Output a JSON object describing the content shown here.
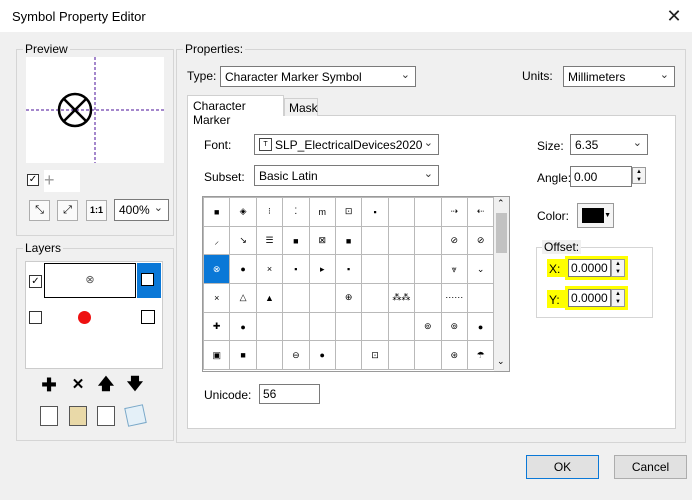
{
  "window": {
    "title": "Symbol Property Editor",
    "close_glyph": "✕"
  },
  "preview": {
    "label": "Preview",
    "zoom": "400%"
  },
  "layers": {
    "label": "Layers",
    "items": [
      {
        "checked": true,
        "symbol": "⊗",
        "lock": "⊡"
      },
      {
        "checked": false,
        "symbol": "●",
        "lock": "⧉"
      }
    ]
  },
  "properties": {
    "label": "Properties:",
    "type_label": "Type:",
    "type_value": "Character Marker Symbol",
    "units_label": "Units:",
    "units_value": "Millimeters",
    "tabs": [
      "Character Marker",
      "Mask"
    ],
    "font_label": "Font:",
    "font_value": "SLP_ElectricalDevices2020",
    "subset_label": "Subset:",
    "subset_value": "Basic Latin",
    "unicode_label": "Unicode:",
    "unicode_value": "56",
    "size_label": "Size:",
    "size_value": "6.35",
    "angle_label": "Angle:",
    "angle_value": "0.00",
    "color_label": "Color:",
    "color_value": "#000000",
    "offset_label": "Offset:",
    "x_label": "X:",
    "x_value": "0.0000",
    "y_label": "Y:",
    "y_value": "0.0000"
  },
  "glyphs": [
    [
      "■",
      "◈",
      "⁝",
      "⁚",
      "m",
      "⊡",
      "▪",
      "",
      "",
      "⇢",
      "⇠"
    ],
    [
      "⸝",
      "↘",
      "☰",
      "■",
      "⊠",
      "■",
      "",
      "",
      "",
      "⊘",
      "⊘"
    ],
    [
      "⊗",
      "●",
      "×",
      "▪",
      "▸",
      "▪",
      "",
      "",
      "",
      "⩔",
      "⌄"
    ],
    [
      "×",
      "△",
      "▲",
      "",
      "",
      "⊕",
      "",
      "⁂⁂",
      "",
      "⋯⋯",
      ""
    ],
    [
      "✚",
      "●",
      "",
      "",
      "",
      "",
      "",
      "",
      "⊚",
      "⊚",
      "●"
    ],
    [
      "▣",
      "■",
      "",
      "⊖",
      "●",
      "",
      "⊡",
      "",
      "",
      "⊛",
      "☂"
    ]
  ],
  "buttons": {
    "ok": "OK",
    "cancel": "Cancel"
  }
}
